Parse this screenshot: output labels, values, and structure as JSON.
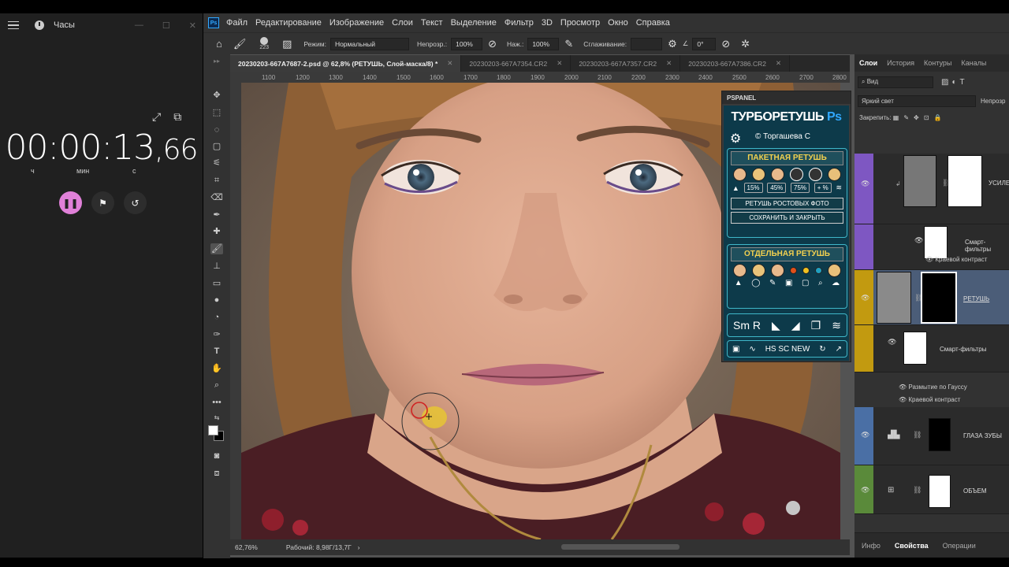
{
  "clock": {
    "title": "Часы",
    "time_main": "00:00:13",
    "time_cs": ",66",
    "units": [
      "ч",
      "мин",
      "с"
    ],
    "buttons": {
      "pause": "❚❚",
      "flag": "⚑",
      "reset": "↺"
    }
  },
  "ps": {
    "menu": [
      "Файл",
      "Редактирование",
      "Изображение",
      "Слои",
      "Текст",
      "Выделение",
      "Фильтр",
      "3D",
      "Просмотр",
      "Окно",
      "Справка"
    ],
    "options": {
      "brush_size": "223",
      "mode_label": "Режим:",
      "mode_value": "Нормальный",
      "opacity_label": "Непрозр.:",
      "opacity_value": "100%",
      "flow_label": "Наж.:",
      "flow_value": "100%",
      "smoothing_label": "Сглаживание:",
      "angle_value": "0°"
    },
    "tabs": [
      {
        "label": "20230203-667A7687-2.psd @ 62,8% (РЕТУШЬ, Слой-маска/8) *"
      },
      {
        "label": "20230203-667A7354.CR2"
      },
      {
        "label": "20230203-667A7357.CR2"
      },
      {
        "label": "20230203-667A7386.CR2"
      }
    ],
    "ruler_top": [
      "1100",
      "1200",
      "1300",
      "1400",
      "1500",
      "1600",
      "1700",
      "1800",
      "1900",
      "2000",
      "2100",
      "2200",
      "2300",
      "2400",
      "2500",
      "2600",
      "2700",
      "2800"
    ],
    "status": {
      "zoom": "62,76%",
      "doc": "Рабочий: 8,98Г/13,7Г"
    },
    "pspanel": {
      "header": "PSPANEL",
      "brand": "ТУРБОРЕТУШЬ",
      "brand_ps": "Ps",
      "copyright": "© Торгашева С",
      "batch_title": "ПАКЕТНАЯ РЕТУШЬ",
      "percents": [
        "15%",
        "45%",
        "75%",
        "+ %"
      ],
      "btn_fullbody": "РЕТУШЬ РОСТОВЫХ ФОТО",
      "btn_save": "СОХРАНИТЬ И ЗАКРЫТЬ",
      "single_title": "ОТДЕЛЬНАЯ РЕТУШЬ",
      "tools_row": "Sm R",
      "bottom_row": "HS SC NEW"
    },
    "layers": {
      "tabs": [
        "Слои",
        "История",
        "Контуры",
        "Каналы"
      ],
      "filter": "Вид",
      "blend": "Яркий свет",
      "opacity_label": "Непрозр",
      "lock_label": "Закрепить:",
      "items": [
        {
          "name": "УСИЛЕ",
          "color": "#7e57c2"
        },
        {
          "name": "Смарт-фильтры",
          "color": "#7e57c2"
        },
        {
          "name": "РЕТУШЬ",
          "color": "#c29a10"
        },
        {
          "name": "Смарт-фильтры",
          "color": "#c29a10"
        },
        {
          "name": "ГЛАЗА ЗУБЫ",
          "color": "#4a6fa5"
        },
        {
          "name": "ОБЪЕМ",
          "color": "#5a8a3a"
        }
      ],
      "subs": [
        "Краевой контраст",
        "Размытие по Гауссу",
        "Краевой контраст"
      ]
    },
    "props_tabs": [
      "Инфо",
      "Свойства",
      "Операции"
    ]
  }
}
